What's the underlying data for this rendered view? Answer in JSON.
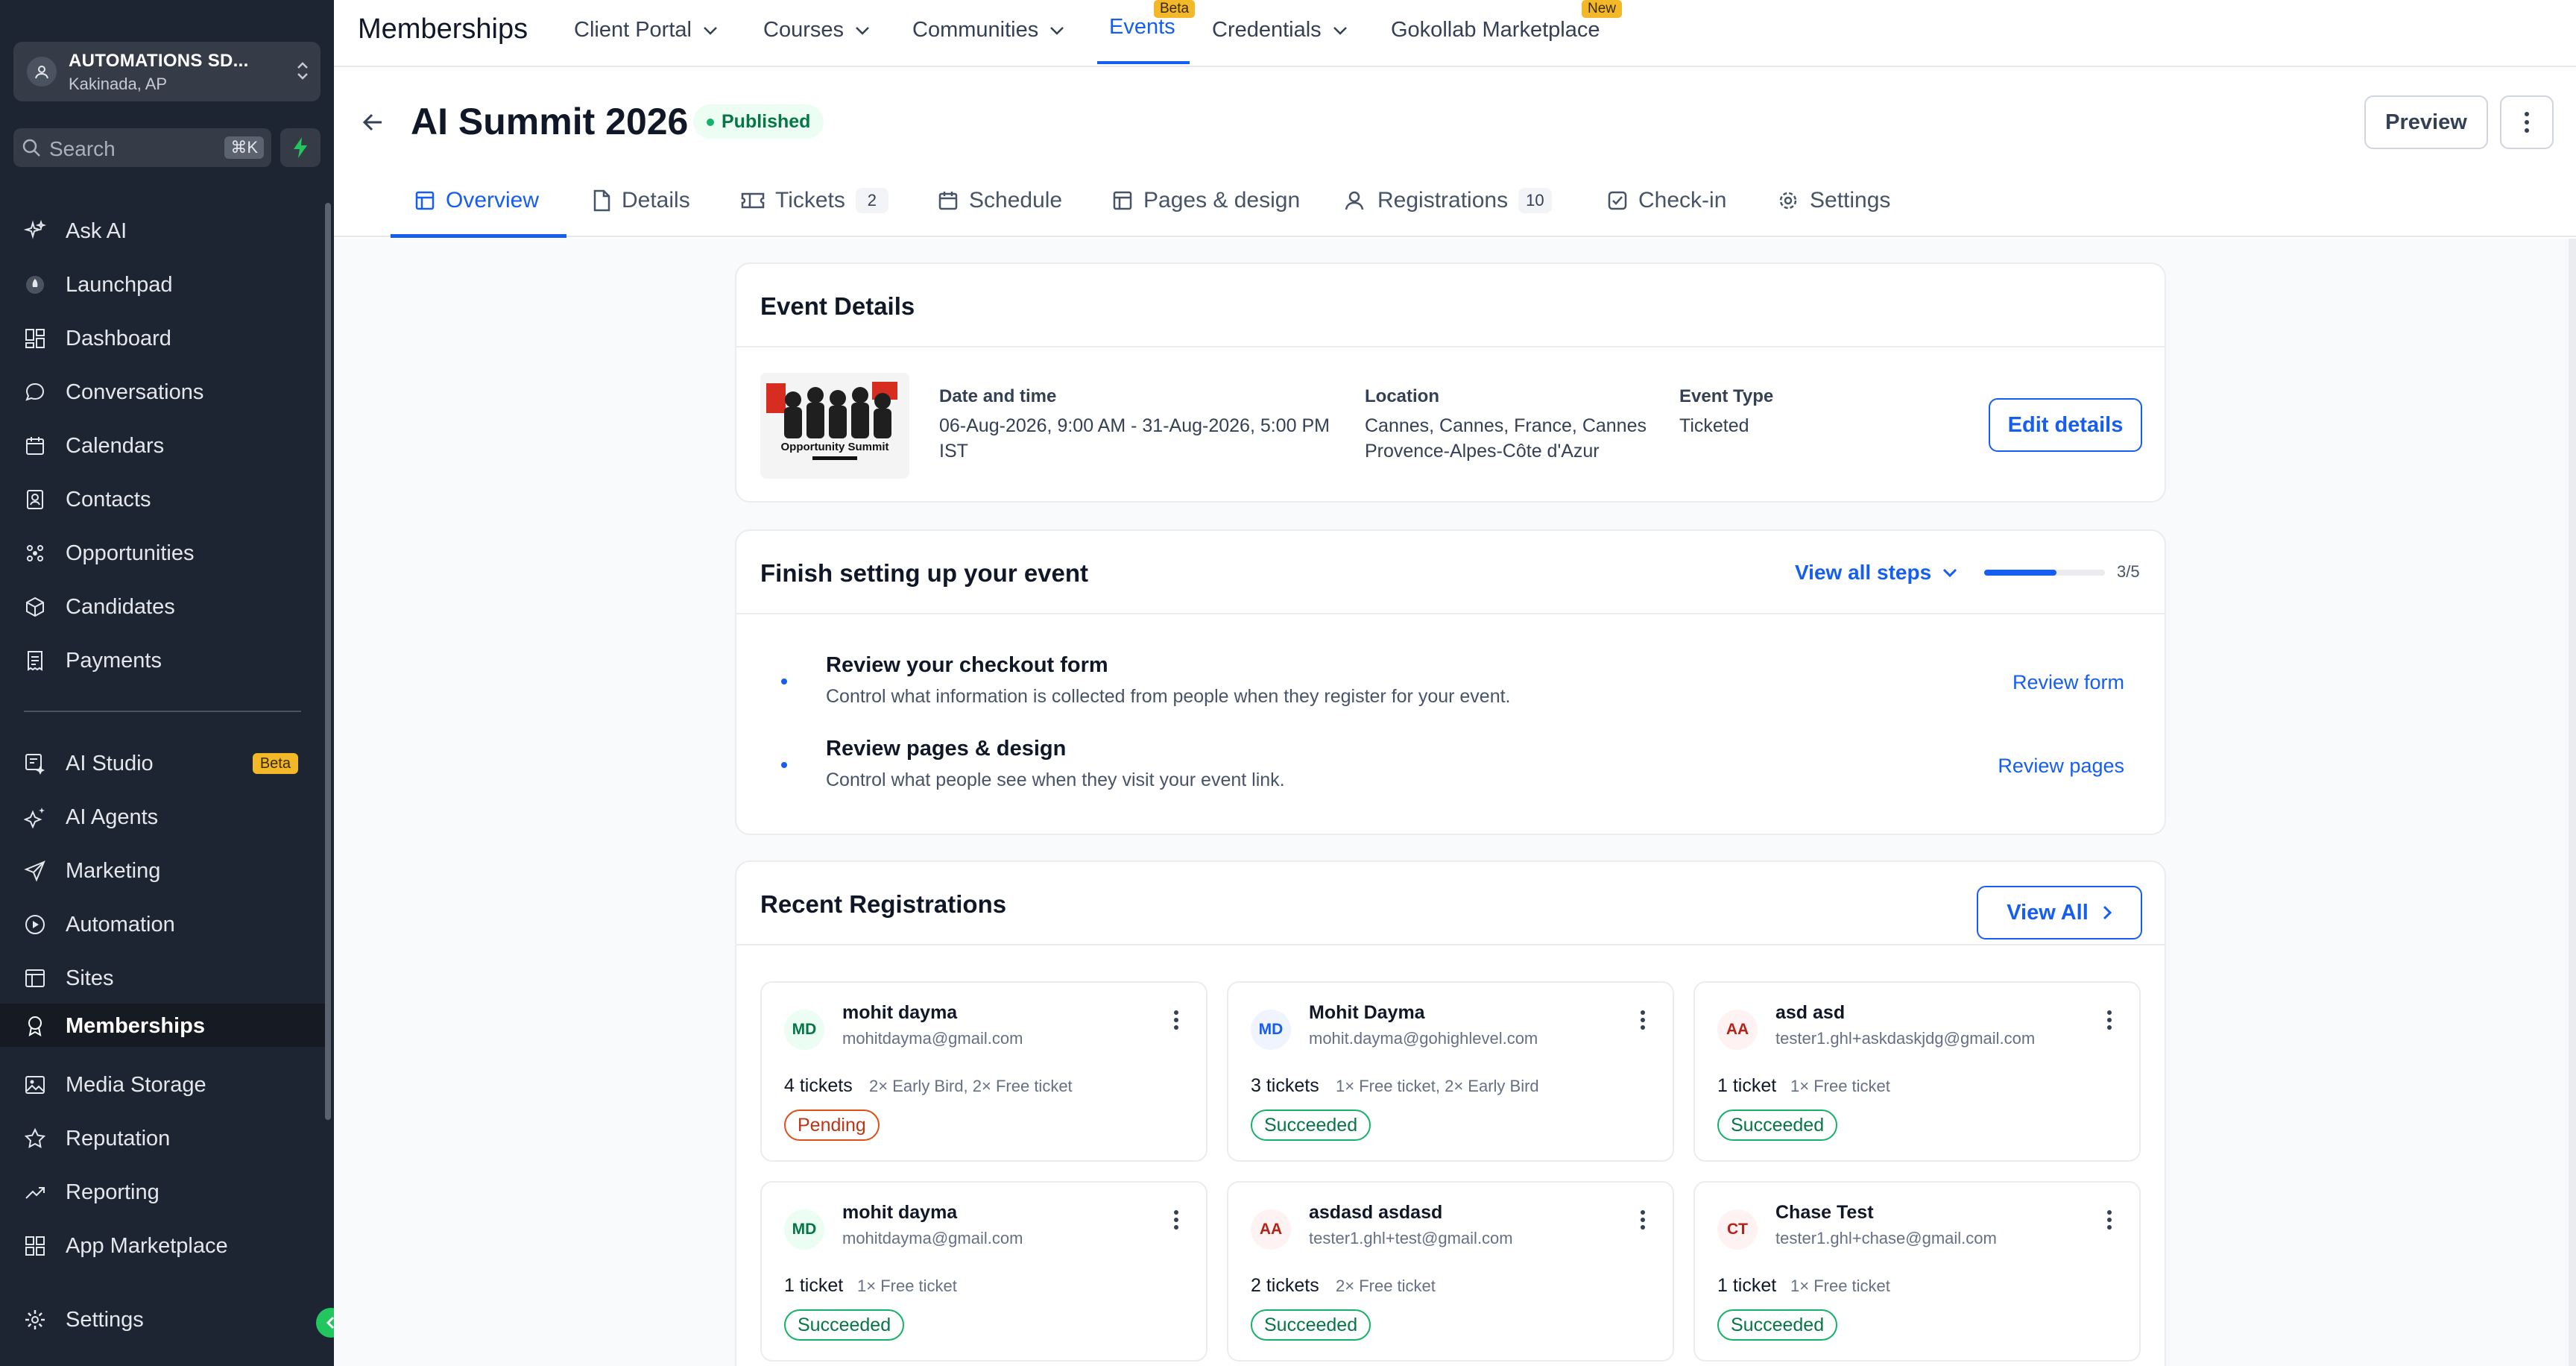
{
  "sidebar": {
    "account": {
      "name": "AUTOMATIONS SD...",
      "location": "Kakinada, AP"
    },
    "search": {
      "placeholder": "Search",
      "shortcut": "⌘K"
    },
    "items": [
      {
        "label": "Ask AI",
        "icon": "sparkles-icon"
      },
      {
        "label": "Launchpad",
        "icon": "rocket-icon"
      },
      {
        "label": "Dashboard",
        "icon": "dashboard-icon"
      },
      {
        "label": "Conversations",
        "icon": "chat-icon"
      },
      {
        "label": "Calendars",
        "icon": "calendar-icon"
      },
      {
        "label": "Contacts",
        "icon": "contacts-icon"
      },
      {
        "label": "Opportunities",
        "icon": "opportunities-icon"
      },
      {
        "label": "Candidates",
        "icon": "cube-icon"
      },
      {
        "label": "Payments",
        "icon": "receipt-icon"
      },
      {
        "label": "AI Studio",
        "icon": "ai-studio-icon",
        "badge": "Beta"
      },
      {
        "label": "AI Agents",
        "icon": "ai-agents-icon"
      },
      {
        "label": "Marketing",
        "icon": "send-icon"
      },
      {
        "label": "Automation",
        "icon": "automation-icon"
      },
      {
        "label": "Sites",
        "icon": "sites-icon"
      },
      {
        "label": "Memberships",
        "icon": "award-icon",
        "active": true
      },
      {
        "label": "Media Storage",
        "icon": "image-icon"
      },
      {
        "label": "Reputation",
        "icon": "star-icon"
      },
      {
        "label": "Reporting",
        "icon": "trend-icon"
      },
      {
        "label": "App Marketplace",
        "icon": "grid-icon"
      },
      {
        "label": "Settings",
        "icon": "gear-icon"
      }
    ]
  },
  "topnav": {
    "brand": "Memberships",
    "items": [
      {
        "label": "Client Portal",
        "dropdown": true
      },
      {
        "label": "Courses",
        "dropdown": true
      },
      {
        "label": "Communities",
        "dropdown": true
      },
      {
        "label": "Events",
        "badge": "Beta",
        "active": true
      },
      {
        "label": "Credentials",
        "dropdown": true
      },
      {
        "label": "Gokollab Marketplace",
        "badge": "New"
      }
    ]
  },
  "header": {
    "title": "AI Summit 2026",
    "status": "Published",
    "preview": "Preview"
  },
  "tabs": [
    {
      "label": "Overview",
      "active": true,
      "icon": "layout-icon"
    },
    {
      "label": "Details",
      "icon": "file-icon"
    },
    {
      "label": "Tickets",
      "count": "2",
      "icon": "ticket-icon"
    },
    {
      "label": "Schedule",
      "icon": "calendar-icon"
    },
    {
      "label": "Pages & design",
      "icon": "pages-icon"
    },
    {
      "label": "Registrations",
      "count": "10",
      "icon": "users-icon"
    },
    {
      "label": "Check-in",
      "icon": "checkbox-icon"
    },
    {
      "label": "Settings",
      "icon": "gear-icon"
    }
  ],
  "event_details": {
    "title": "Event Details",
    "thumb_caption": "Opportunity Summit",
    "date_label": "Date and time",
    "date_value": "06-Aug-2026, 9:00 AM - 31-Aug-2026, 5:00 PM IST",
    "location_label": "Location",
    "location_value": "Cannes, Cannes, France, Cannes Provence-Alpes-Côte d'Azur",
    "type_label": "Event Type",
    "type_value": "Ticketed",
    "edit": "Edit details"
  },
  "setup": {
    "title": "Finish setting up your event",
    "view_all": "View all steps",
    "progress_text": "3/5",
    "progress_fraction": 0.6,
    "steps": [
      {
        "title": "Review your checkout form",
        "desc": "Control what information is collected from people when they register for your event.",
        "action": "Review form"
      },
      {
        "title": "Review pages & design",
        "desc": "Control what people see when they visit your event link.",
        "action": "Review pages"
      }
    ]
  },
  "registrations": {
    "title": "Recent Registrations",
    "view_all": "View All",
    "items": [
      {
        "initials": "MD",
        "name": "mohit dayma",
        "email": "mohitdayma@gmail.com",
        "tickets": "4 tickets",
        "detail": "2× Early Bird, 2× Free ticket",
        "status": "Pending"
      },
      {
        "initials": "MD",
        "name": "Mohit Dayma",
        "email": "mohit.dayma@gohighlevel.com",
        "tickets": "3 tickets",
        "detail": "1× Free ticket, 2× Early Bird",
        "status": "Succeeded"
      },
      {
        "initials": "AA",
        "name": "asd asd",
        "email": "tester1.ghl+askdaskjdg@gmail.com",
        "tickets": "1 ticket",
        "detail": "1× Free ticket",
        "status": "Succeeded"
      },
      {
        "initials": "MD",
        "name": "mohit dayma",
        "email": "mohitdayma@gmail.com",
        "tickets": "1 ticket",
        "detail": "1× Free ticket",
        "status": "Succeeded"
      },
      {
        "initials": "AA",
        "name": "asdasd asdasd",
        "email": "tester1.ghl+test@gmail.com",
        "tickets": "2 tickets",
        "detail": "2× Free ticket",
        "status": "Succeeded"
      },
      {
        "initials": "CT",
        "name": "Chase Test",
        "email": "tester1.ghl+chase@gmail.com",
        "tickets": "1 ticket",
        "detail": "1× Free ticket",
        "status": "Succeeded"
      }
    ]
  },
  "colors": {
    "accent": "#155eef",
    "sidebar_bg": "#1e2532",
    "success": "#17b26a",
    "warning": "#e04f16",
    "badge_yellow": "#f2b828"
  }
}
